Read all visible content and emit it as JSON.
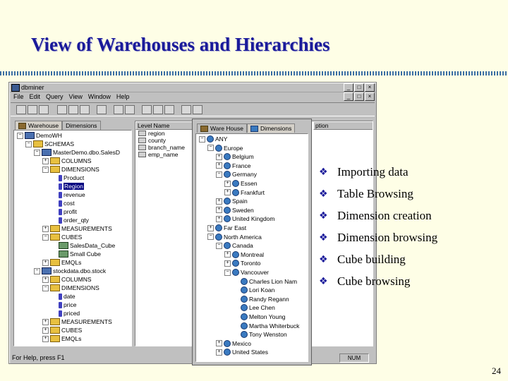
{
  "slide": {
    "title": "View of Warehouses and Hierarchies",
    "page_number": "24"
  },
  "app": {
    "window_title": "dbminer",
    "menu": [
      "File",
      "Edit",
      "Query",
      "View",
      "Window",
      "Help"
    ],
    "window_buttons": [
      "_",
      "□",
      "×"
    ],
    "tabs": [
      {
        "label": "Warehouse",
        "active": true
      },
      {
        "label": "Dimensions",
        "active": false
      }
    ],
    "tree": [
      {
        "label": "DemoWH",
        "depth": 0,
        "icon": "db-icon",
        "toggle": "−"
      },
      {
        "label": "SCHEMAS",
        "depth": 1,
        "icon": "folder-icon",
        "toggle": "−"
      },
      {
        "label": "MasterDemo.dbo.SalesD",
        "depth": 2,
        "icon": "db-icon",
        "toggle": "−"
      },
      {
        "label": "COLUMNS",
        "depth": 3,
        "icon": "folder-icon",
        "toggle": "+"
      },
      {
        "label": "DIMENSIONS",
        "depth": 3,
        "icon": "folder-icon",
        "toggle": "−"
      },
      {
        "label": "Product",
        "depth": 4,
        "icon": "attribute-icon",
        "toggle": ""
      },
      {
        "label": "Region",
        "depth": 4,
        "icon": "attribute-icon",
        "toggle": "",
        "selected": true
      },
      {
        "label": "revenue",
        "depth": 4,
        "icon": "attribute-icon",
        "toggle": ""
      },
      {
        "label": "cost",
        "depth": 4,
        "icon": "attribute-icon",
        "toggle": ""
      },
      {
        "label": "profit",
        "depth": 4,
        "icon": "attribute-icon",
        "toggle": ""
      },
      {
        "label": "order_qty",
        "depth": 4,
        "icon": "attribute-icon",
        "toggle": ""
      },
      {
        "label": "MEASUREMENTS",
        "depth": 3,
        "icon": "folder-icon",
        "toggle": "+"
      },
      {
        "label": "CUBES",
        "depth": 3,
        "icon": "folder-icon",
        "toggle": "−"
      },
      {
        "label": "SalesData_Cube",
        "depth": 4,
        "icon": "cube-icon",
        "toggle": ""
      },
      {
        "label": "Small Cube",
        "depth": 4,
        "icon": "cube-icon",
        "toggle": ""
      },
      {
        "label": "EMQLs",
        "depth": 3,
        "icon": "folder-icon",
        "toggle": "+"
      },
      {
        "label": "stockdata.dbo.stock",
        "depth": 2,
        "icon": "db-icon",
        "toggle": "−"
      },
      {
        "label": "COLUMNS",
        "depth": 3,
        "icon": "folder-icon",
        "toggle": "+"
      },
      {
        "label": "DIMENSIONS",
        "depth": 3,
        "icon": "folder-icon",
        "toggle": "−"
      },
      {
        "label": "date",
        "depth": 4,
        "icon": "attribute-icon",
        "toggle": ""
      },
      {
        "label": "price",
        "depth": 4,
        "icon": "attribute-icon",
        "toggle": ""
      },
      {
        "label": "priced",
        "depth": 4,
        "icon": "attribute-icon",
        "toggle": ""
      },
      {
        "label": "MEASUREMENTS",
        "depth": 3,
        "icon": "folder-icon",
        "toggle": "+"
      },
      {
        "label": "CUBES",
        "depth": 3,
        "icon": "folder-icon",
        "toggle": "+"
      },
      {
        "label": "EMQLs",
        "depth": 3,
        "icon": "folder-icon",
        "toggle": "+"
      }
    ],
    "level_header": "Level Name",
    "desc_header": "ption",
    "levels": [
      "region",
      "county",
      "branch_name",
      "emp_name"
    ],
    "status_text": "For Help, press F1",
    "status_num": "NUM"
  },
  "dim_window": {
    "tabs": [
      {
        "label": "Ware House",
        "active": false
      },
      {
        "label": "Dimensions",
        "active": true
      }
    ],
    "tree": [
      {
        "label": "ANY",
        "depth": 0,
        "toggle": "−"
      },
      {
        "label": "Europe",
        "depth": 1,
        "toggle": "−"
      },
      {
        "label": "Belgium",
        "depth": 2,
        "toggle": "+"
      },
      {
        "label": "France",
        "depth": 2,
        "toggle": "+"
      },
      {
        "label": "Germany",
        "depth": 2,
        "toggle": "−"
      },
      {
        "label": "Essen",
        "depth": 3,
        "toggle": "+"
      },
      {
        "label": "Frankfurt",
        "depth": 3,
        "toggle": "+"
      },
      {
        "label": "Spain",
        "depth": 2,
        "toggle": "+"
      },
      {
        "label": "Sweden",
        "depth": 2,
        "toggle": "+"
      },
      {
        "label": "United Kingdom",
        "depth": 2,
        "toggle": "+"
      },
      {
        "label": "Far East",
        "depth": 1,
        "toggle": "+"
      },
      {
        "label": "North America",
        "depth": 1,
        "toggle": "−"
      },
      {
        "label": "Canada",
        "depth": 2,
        "toggle": "−"
      },
      {
        "label": "Montreal",
        "depth": 3,
        "toggle": "+"
      },
      {
        "label": "Toronto",
        "depth": 3,
        "toggle": "+"
      },
      {
        "label": "Vancouver",
        "depth": 3,
        "toggle": "−"
      },
      {
        "label": "Charles Lion Nam",
        "depth": 4,
        "toggle": ""
      },
      {
        "label": "Lori Koan",
        "depth": 4,
        "toggle": ""
      },
      {
        "label": "Randy Regann",
        "depth": 4,
        "toggle": ""
      },
      {
        "label": "Lee Chen",
        "depth": 4,
        "toggle": ""
      },
      {
        "label": "Melton Young",
        "depth": 4,
        "toggle": ""
      },
      {
        "label": "Martha Whiterbuck",
        "depth": 4,
        "toggle": ""
      },
      {
        "label": "Tony Wenston",
        "depth": 4,
        "toggle": ""
      },
      {
        "label": "Mexico",
        "depth": 2,
        "toggle": "+"
      },
      {
        "label": "United States",
        "depth": 2,
        "toggle": "+"
      }
    ]
  },
  "bullets": [
    "Importing data",
    "Table Browsing",
    "Dimension creation",
    "Dimension browsing",
    "Cube building",
    "Cube browsing"
  ],
  "colors": {
    "background": "#fefee6",
    "title": "#1a1a9a",
    "window_gray": "#c0c0c0"
  }
}
